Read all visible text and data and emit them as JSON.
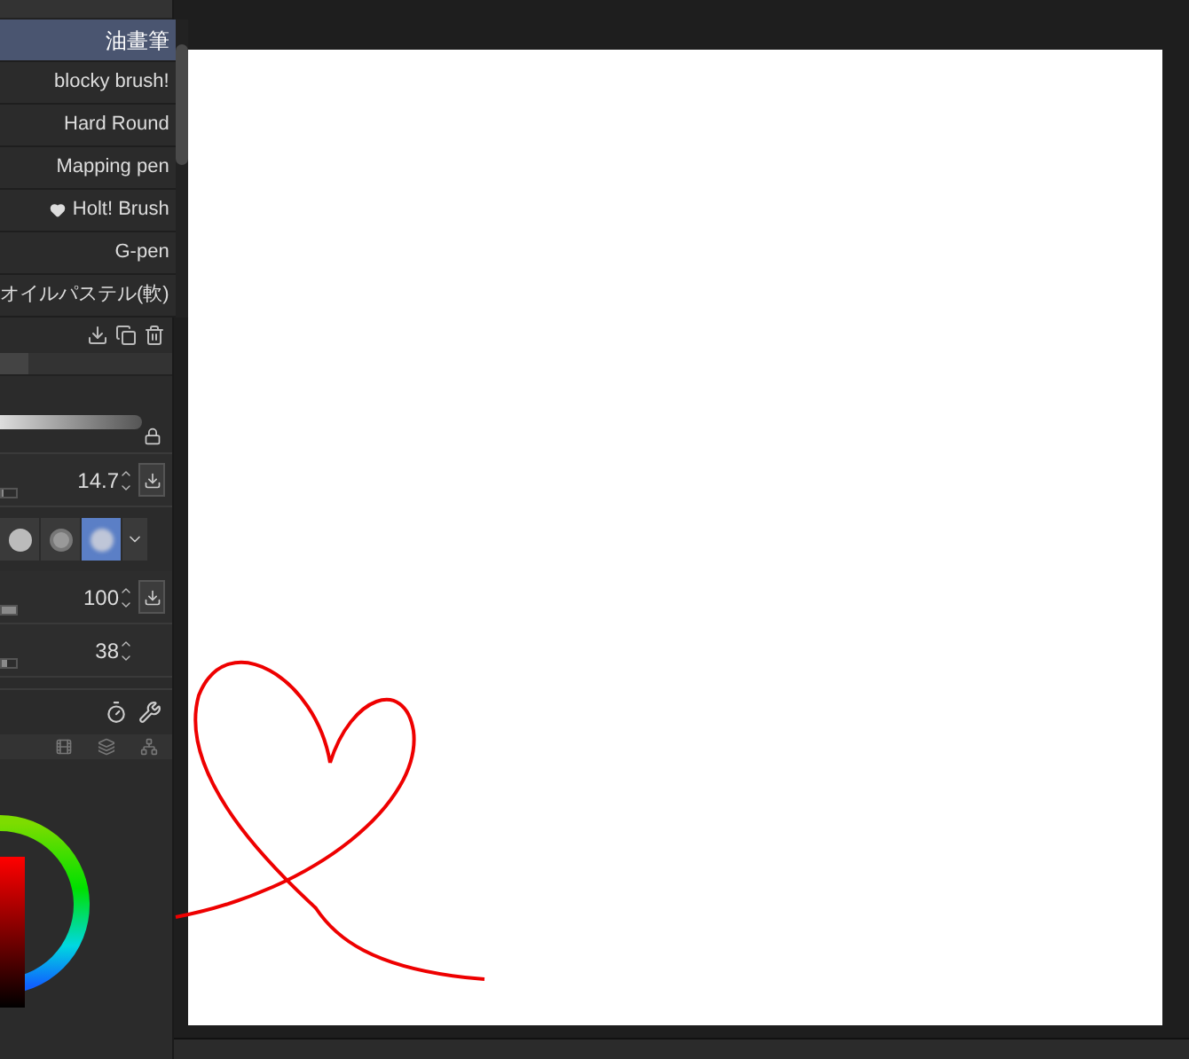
{
  "brushes": [
    {
      "label": "油畫筆",
      "selected": true,
      "favorite": false
    },
    {
      "label": "blocky brush!",
      "selected": false,
      "favorite": false
    },
    {
      "label": "Hard Round",
      "selected": false,
      "favorite": false
    },
    {
      "label": "Mapping pen",
      "selected": false,
      "favorite": false
    },
    {
      "label": "Holt! Brush",
      "selected": false,
      "favorite": true
    },
    {
      "label": "G-pen",
      "selected": false,
      "favorite": false
    },
    {
      "label": "オイルパステル(軟)",
      "selected": false,
      "favorite": false
    }
  ],
  "properties": [
    {
      "kind": "slider",
      "value": "14.7",
      "level": 0.1,
      "save": true
    },
    {
      "kind": "tips",
      "tips": [
        {
          "selected": false
        },
        {
          "selected": false
        },
        {
          "selected": true
        }
      ]
    },
    {
      "kind": "slider",
      "value": "100",
      "level": 1.0,
      "save": true
    },
    {
      "kind": "slider",
      "value": "38",
      "level": 0.38,
      "save": false
    }
  ]
}
